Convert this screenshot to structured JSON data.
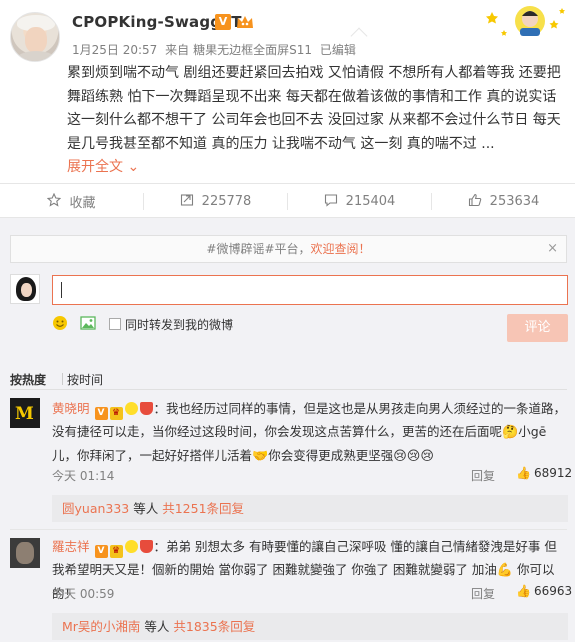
{
  "post": {
    "username": "CPOPKing-SwaggyT",
    "vip_badge": "V",
    "date": "1月25日 20:57",
    "source_prefix": "来自",
    "source": "糖果无边框全面屏S11",
    "edited": "已编辑",
    "text": "累到烦到喘不动气 剧组还要赶紧回去拍戏 又怕请假  不想所有人都着等我 还要把舞蹈练熟 怕下一次舞蹈呈现不出来 每天都在做着该做的事情和工作 真的说实话 这一刻什么都不想干了 公司年会也回不去  没回过家  从来都不会过什么节日 每天是几号我甚至都不知道  真的压力 让我喘不动气 这一刻 真的喘不过 ...",
    "expand_label": "展开全文",
    "expand_icon": "chevron-down-icon"
  },
  "actions": {
    "favorite": {
      "label": "收藏",
      "icon": "star-icon"
    },
    "repost": {
      "count": "225778",
      "icon": "repost-icon"
    },
    "comment": {
      "count": "215404",
      "icon": "comment-icon"
    },
    "like": {
      "count": "253634",
      "icon": "thumbs-up-icon"
    }
  },
  "comment_box": {
    "notice_prefix": "#微博辟谣#平台，",
    "notice_highlight": "欢迎查阅！",
    "notice_close": "×",
    "repost_checkbox_label": "同时转发到我的微博",
    "submit_label": "评论"
  },
  "sort": {
    "hot": "按热度",
    "time": "按时间"
  },
  "comments": [
    {
      "name": "黄晓明",
      "text_a": "：我也经历过同样的事情，但是这也是从男孩走向男人须经过的一条道路，没有捷径可以走，当你经过这段时间，你会发现这点苦算什么，更苦的还在后面呢",
      "text_b": "小gē儿，你拜闲了，一起好好搭伴儿活着",
      "text_c": "你会变得更成熟更坚强",
      "time": "今天 01:14",
      "reply_label": "回复",
      "likes": "68912",
      "reply_user": "圆yuan333",
      "reply_middle": " 等人 ",
      "reply_total": "共1251条回复"
    },
    {
      "name": "羅志祥",
      "text_a": "：弟弟 别想太多 有時要懂的讓自己深呼吸 懂的讓自己情緒發洩是好事 但我希望明天又是！個新的開始 當你弱了 困難就變強了 你強了 困難就變弱了 加油",
      "text_b": " 你可以的！",
      "time": "今天 00:59",
      "reply_label": "回复",
      "likes": "66963",
      "reply_user": "Mr吴的小湘南",
      "reply_middle": " 等人 ",
      "reply_total": "共1835条回复"
    }
  ],
  "colors": {
    "accent": "#eb7350",
    "background": "#f2f2f5",
    "muted_text": "#808080",
    "submit_disabled": "#f7c5b5"
  }
}
